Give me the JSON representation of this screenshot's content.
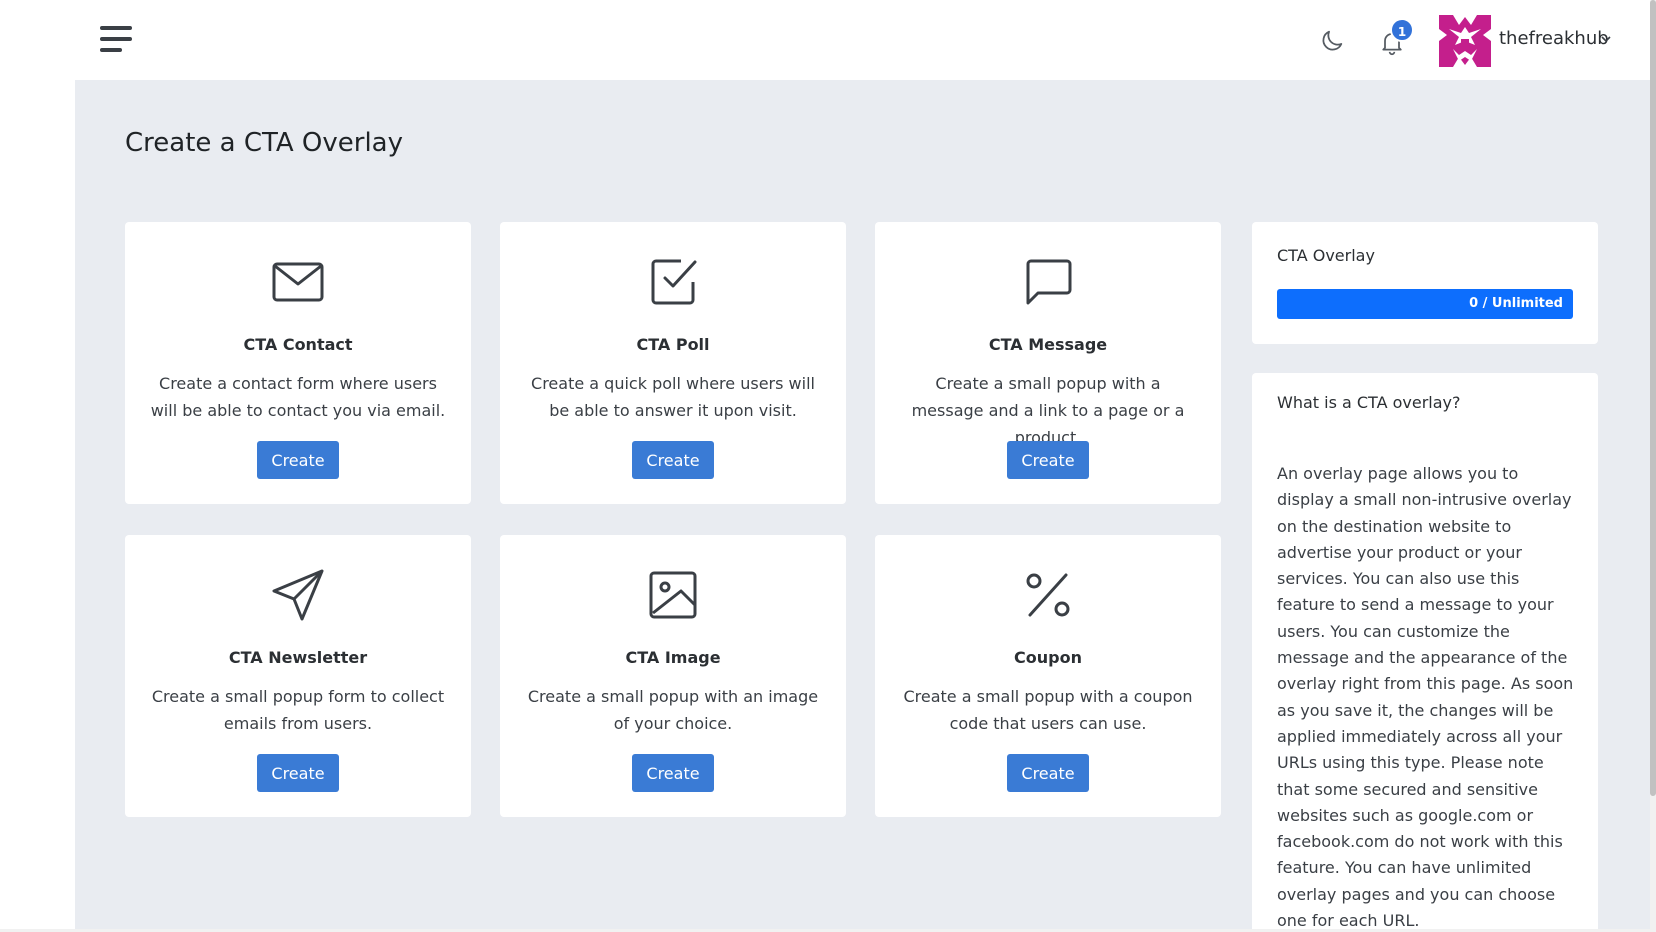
{
  "header": {
    "username": "thefreakhub",
    "notification_count": "1",
    "brand_color": "#3a7bd5"
  },
  "page": {
    "title": "Create a CTA Overlay"
  },
  "cards": [
    {
      "icon": "envelope-icon",
      "title": "CTA Contact",
      "description": "Create a contact form where users will be able to contact you via email.",
      "button": "Create"
    },
    {
      "icon": "check-square-icon",
      "title": "CTA Poll",
      "description": "Create a quick poll where users will be able to answer it upon visit.",
      "button": "Create"
    },
    {
      "icon": "chat-bubble-icon",
      "title": "CTA Message",
      "description": "Create a small popup with a message and a link to a page or a product.",
      "button": "Create"
    },
    {
      "icon": "send-icon",
      "title": "CTA Newsletter",
      "description": "Create a small popup form to collect emails from users.",
      "button": "Create"
    },
    {
      "icon": "image-icon",
      "title": "CTA Image",
      "description": "Create a small popup with an image of your choice.",
      "button": "Create"
    },
    {
      "icon": "percent-icon",
      "title": "Coupon",
      "description": "Create a small popup with a coupon code that users can use.",
      "button": "Create"
    }
  ],
  "usage": {
    "title": "CTA Overlay",
    "label": "0 / Unlimited",
    "fill_fraction": 1.0
  },
  "info": {
    "title": "What is a CTA overlay?",
    "text": "An overlay page allows you to display a small non-intrusive overlay on the destination website to advertise your product or your services. You can also use this feature to send a message to your users. You can customize the message and the appearance of the overlay right from this page. As soon as you save it, the changes will be applied immediately across all your URLs using this type. Please note that some secured and sensitive websites such as google.com or facebook.com do not work with this feature. You can have unlimited overlay pages and you can choose one for each URL."
  }
}
